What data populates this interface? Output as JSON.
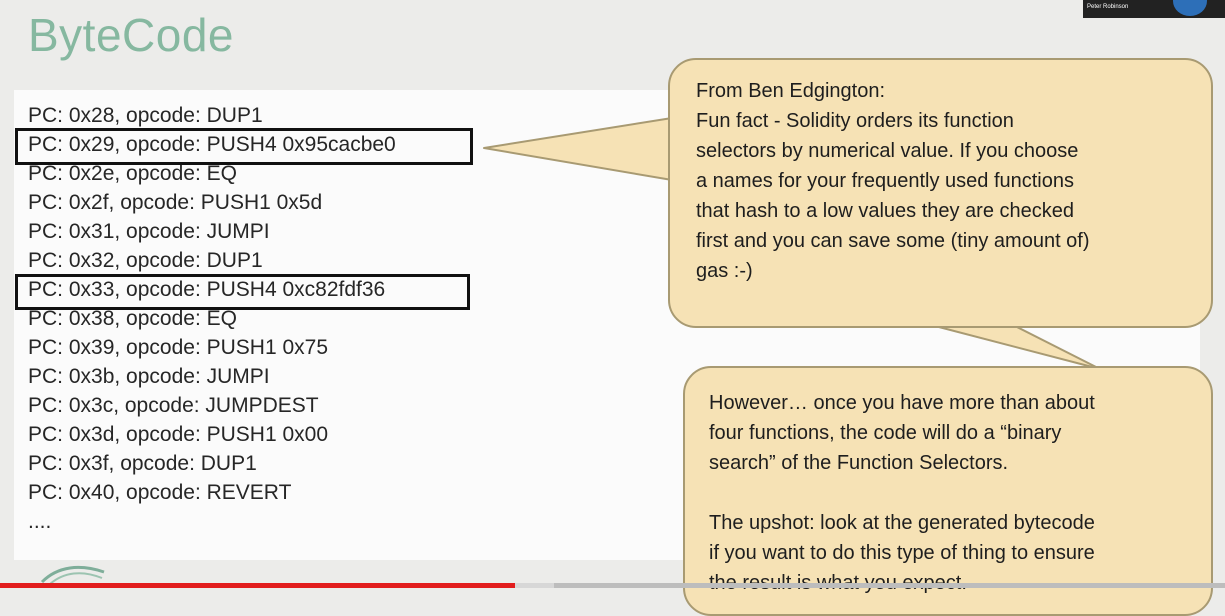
{
  "slide": {
    "title": "ByteCode"
  },
  "code_lines": [
    "PC: 0x28, opcode: DUP1",
    "PC: 0x29, opcode: PUSH4 0x95cacbe0",
    "PC: 0x2e, opcode: EQ",
    "PC: 0x2f, opcode: PUSH1 0x5d",
    "PC: 0x31, opcode: JUMPI",
    "PC: 0x32, opcode: DUP1",
    "PC: 0x33, opcode: PUSH4 0xc82fdf36",
    "PC: 0x38, opcode: EQ",
    "PC: 0x39, opcode: PUSH1 0x75",
    "PC: 0x3b, opcode: JUMPI",
    "PC: 0x3c, opcode: JUMPDEST",
    "PC: 0x3d, opcode: PUSH1 0x00",
    "PC: 0x3f, opcode: DUP1",
    "PC: 0x40, opcode: REVERT",
    "...."
  ],
  "callout_1": {
    "lines": [
      "From Ben Edgington:",
      "Fun fact - Solidity orders its function",
      "selectors by numerical value. If you choose",
      "a names for your frequently used functions",
      "that hash to a low values they are checked",
      "first and you can save some (tiny amount of)",
      "gas :-)"
    ]
  },
  "callout_2": {
    "lines": [
      "However… once you have more than about",
      "four functions, the code will do a “binary",
      "search” of the Function Selectors.",
      "",
      "The upshot: look at the generated bytecode",
      "if you want to do this type of thing to ensure",
      "the result is what you expect."
    ]
  },
  "presenter": {
    "name": "Peter Robinson"
  },
  "video": {
    "progress": 0.42,
    "buffered": 0.452
  },
  "colors": {
    "title": "#86b8a0",
    "callout_fill": "#f6e2b5",
    "callout_border": "#a89a72",
    "progress": "#e21d1d"
  }
}
